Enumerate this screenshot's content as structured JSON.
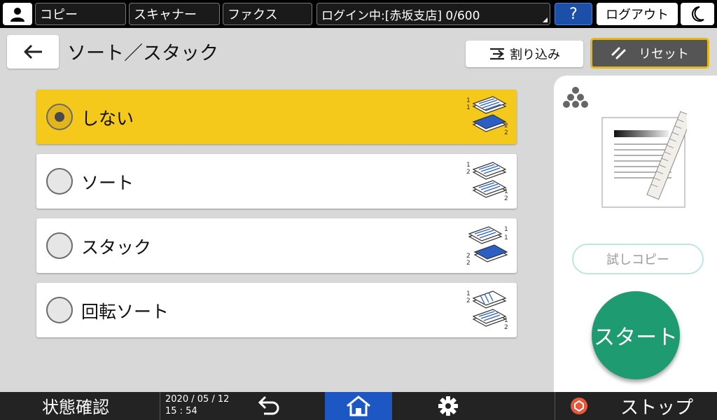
{
  "topbar": {
    "copy_label": "コピー",
    "scanner_label": "スキャナー",
    "fax_label": "ファクス",
    "login_status": "ログイン中:[赤坂支店] 0/600",
    "help_label": "?",
    "logout_label": "ログアウト"
  },
  "header": {
    "title": "ソート／スタック",
    "interrupt_label": "割り込み",
    "reset_label": "リセット"
  },
  "options": [
    {
      "label": "しない",
      "selected": true,
      "numbers": [
        "1",
        "1",
        "2",
        "2"
      ]
    },
    {
      "label": "ソート",
      "selected": false,
      "numbers": [
        "1",
        "2",
        "1",
        "2"
      ]
    },
    {
      "label": "スタック",
      "selected": false,
      "numbers": [
        "1",
        "1",
        "2",
        "2"
      ]
    },
    {
      "label": "回転ソート",
      "selected": false,
      "numbers": [
        "1",
        "2",
        "1",
        "2"
      ]
    }
  ],
  "right_panel": {
    "trial_copy_label": "試しコピー",
    "start_label": "スタート"
  },
  "bottombar": {
    "status_label": "状態確認",
    "date": "2020 / 05 / 12",
    "time": "15 : 54",
    "stop_label": "ストップ"
  },
  "colors": {
    "selected": "#f5c81c",
    "start": "#1f9b72",
    "home": "#1c57c4",
    "reset_border": "#e7b81e",
    "stack_blue": "#2c5fc4"
  }
}
